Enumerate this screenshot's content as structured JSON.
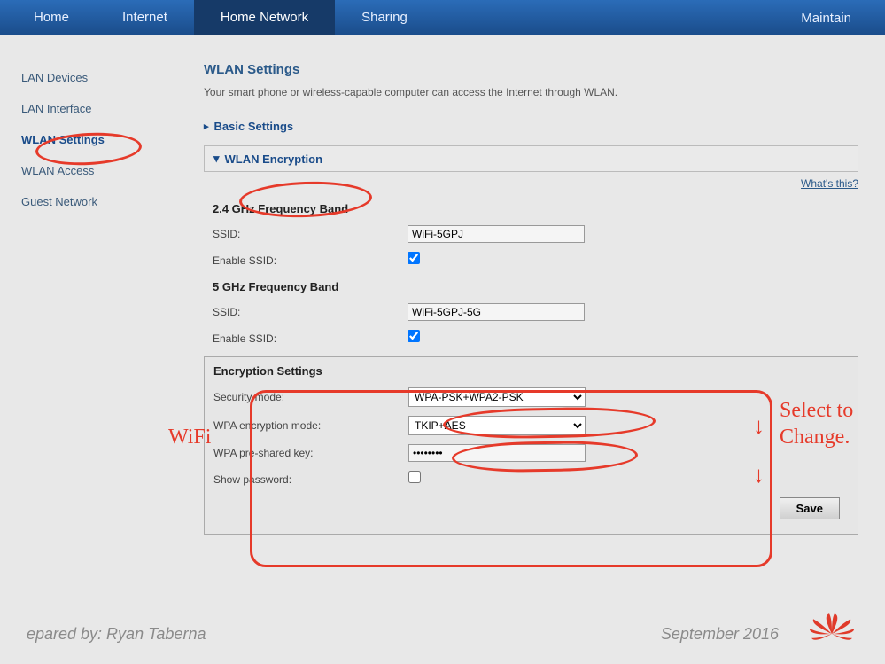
{
  "topnav": {
    "tabs": [
      "Home",
      "Internet",
      "Home Network",
      "Sharing"
    ],
    "active_index": 2,
    "maintain": "Maintain"
  },
  "sidebar": {
    "items": [
      "LAN Devices",
      "LAN Interface",
      "WLAN Settings",
      "WLAN Access",
      "Guest Network"
    ],
    "selected_index": 2
  },
  "main": {
    "title": "WLAN Settings",
    "desc": "Your smart phone or wireless-capable computer can access the Internet through WLAN.",
    "basic_settings_label": "Basic Settings",
    "wlan_encryption_label": "WLAN Encryption",
    "whats_this": "What's this?",
    "band24": {
      "title": "2.4 GHz Frequency Band",
      "ssid_label": "SSID:",
      "ssid_value": "WiFi-5GPJ",
      "enable_ssid_label": "Enable SSID:",
      "enable_ssid_checked": true
    },
    "band5": {
      "title": "5 GHz Frequency Band",
      "ssid_label": "SSID:",
      "ssid_value": "WiFi-5GPJ-5G",
      "enable_ssid_label": "Enable SSID:",
      "enable_ssid_checked": true
    },
    "encryption": {
      "title": "Encryption Settings",
      "security_mode_label": "Security mode:",
      "security_mode_value": "WPA-PSK+WPA2-PSK",
      "wpa_mode_label": "WPA encryption mode:",
      "wpa_mode_value": "TKIP+AES",
      "psk_label": "WPA pre-shared key:",
      "psk_value": "••••••••",
      "show_pw_label": "Show password:",
      "show_pw_checked": false,
      "save_label": "Save"
    }
  },
  "annotations": {
    "wifi_text": "WiFi",
    "select_text_1": "Select to",
    "select_text_2": "Change."
  },
  "footer": {
    "prepared": "epared by: Ryan Taberna",
    "date": "September 2016"
  }
}
